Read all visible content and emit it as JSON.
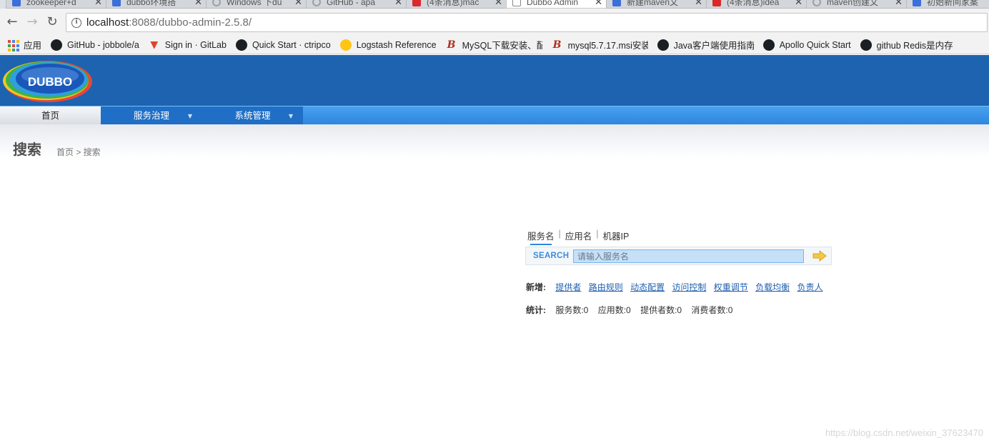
{
  "browser": {
    "tabs": [
      {
        "title": "zookeeper+d",
        "favicon": "baidu",
        "color": "#3b6fd9"
      },
      {
        "title": "dubbo环境搭",
        "favicon": "baidu",
        "color": "#3b6fd9"
      },
      {
        "title": "Windows 下du",
        "favicon": "loading",
        "color": "#9aa0a6"
      },
      {
        "title": "GitHub - apa",
        "favicon": "loading",
        "color": "#9aa0a6"
      },
      {
        "title": "(4条消息)mac",
        "favicon": "csdn",
        "color": "#d9292a"
      },
      {
        "title": "Dubbo Admin",
        "favicon": "page",
        "color": "#ffffff"
      },
      {
        "title": "新建maven文",
        "favicon": "baidu",
        "color": "#3b6fd9"
      },
      {
        "title": "(4条消息)idea",
        "favicon": "csdn",
        "color": "#d9292a"
      },
      {
        "title": "maven创建文",
        "favicon": "loading",
        "color": "#9aa0a6"
      },
      {
        "title": "初始新间家案",
        "favicon": "baidu",
        "color": "#3b6fd9"
      }
    ],
    "url_host": "localhost",
    "url_rest": ":8088/dubbo-admin-2.5.8/",
    "bookmarks": [
      {
        "label": "应用",
        "icon": "apps-icon"
      },
      {
        "label": "GitHub - jobbole/a",
        "icon": "github-icon"
      },
      {
        "label": "Sign in · GitLab",
        "icon": "gitlab-icon"
      },
      {
        "label": "Quick Start · ctripco",
        "icon": "github-icon"
      },
      {
        "label": "Logstash Reference",
        "icon": "logstash-icon"
      },
      {
        "label": "MySQL下载安装、配",
        "icon": "bootcss-icon"
      },
      {
        "label": "mysql5.7.17.msi安装",
        "icon": "bootcss-icon"
      },
      {
        "label": "Java客户端使用指南",
        "icon": "github-icon"
      },
      {
        "label": "Apollo Quick Start",
        "icon": "github-icon"
      },
      {
        "label": "github Redis是内存",
        "icon": "github-icon"
      }
    ]
  },
  "app": {
    "logo_text": "DUBBO",
    "menu": [
      {
        "label": "首页"
      },
      {
        "label": "服务治理"
      },
      {
        "label": "系统管理"
      }
    ],
    "page_title": "搜索",
    "breadcrumb": "首页 > 搜索"
  },
  "search": {
    "tabs": [
      "服务名",
      "应用名",
      "机器IP"
    ],
    "label": "SEARCH",
    "placeholder": "请输入服务名",
    "add_label": "新增:",
    "add_links": [
      "提供者",
      "路由规则",
      "动态配置",
      "访问控制",
      "权重调节",
      "负载均衡",
      "负责人"
    ],
    "stat_label": "统计:",
    "stats": [
      "服务数:0",
      "应用数:0",
      "提供者数:0",
      "消费者数:0"
    ]
  },
  "watermark": "https://blog.csdn.net/weixin_37623470",
  "colors": {
    "header": "#1e63b0",
    "menubar": "#2e86de",
    "link": "#1f5fb0",
    "search_accent": "#3b8cdb"
  }
}
